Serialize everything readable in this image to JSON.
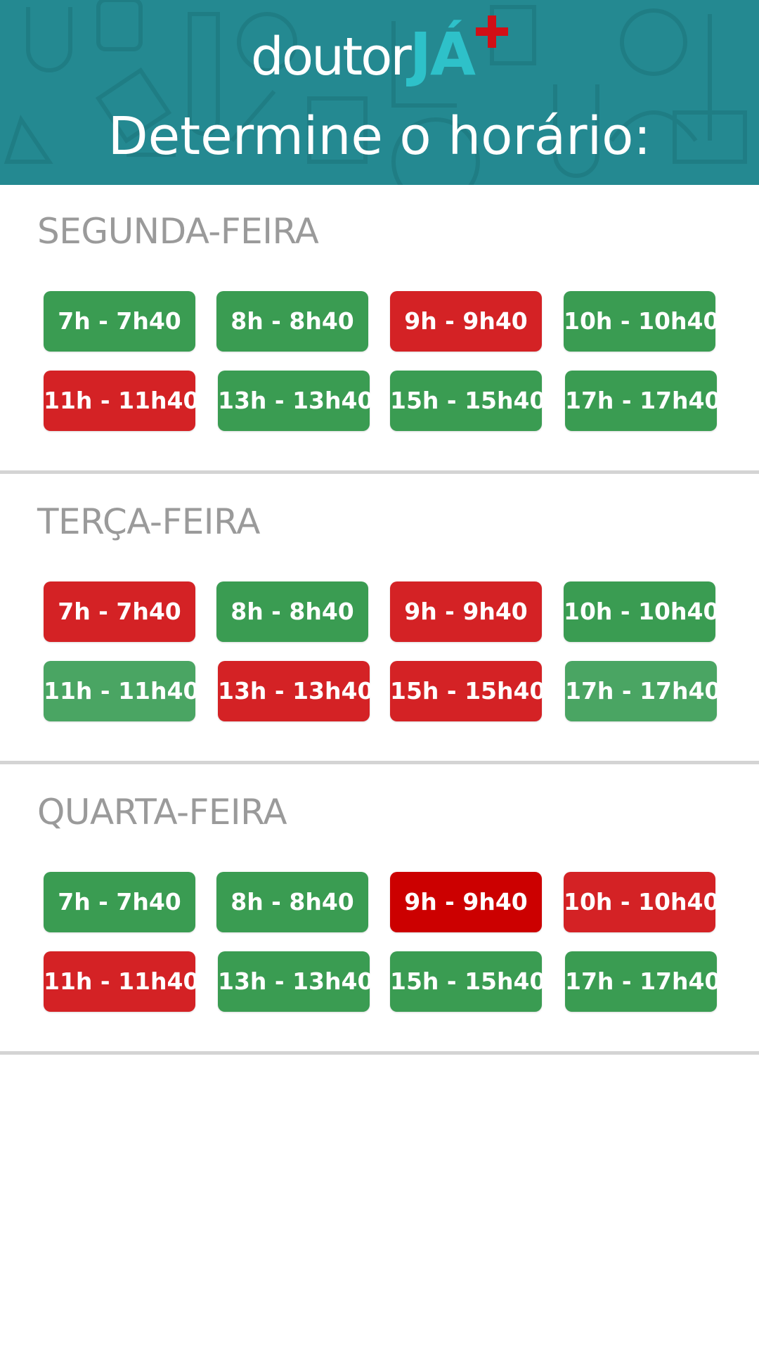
{
  "header": {
    "logo": {
      "text_main": "doutor",
      "text_accent": "JÁ"
    },
    "title": "Determine o horário:",
    "background_color": "#248991",
    "logo_accent_color": "#2ec1c9",
    "logo_plus_color": "#d10f16"
  },
  "colors": {
    "available": "#3a9c52",
    "available_light": "#4aa563",
    "unavailable": "#d42225",
    "unavailable_dark": "#cc0000"
  },
  "days": [
    {
      "name": "SEGUNDA-FEIRA",
      "slots": [
        {
          "label": "7h - 7h40",
          "status": "available"
        },
        {
          "label": "8h - 8h40",
          "status": "available"
        },
        {
          "label": "9h - 9h40",
          "status": "unavailable"
        },
        {
          "label": "10h - 10h40",
          "status": "available"
        },
        {
          "label": "11h - 11h40",
          "status": "unavailable"
        },
        {
          "label": "13h - 13h40",
          "status": "available"
        },
        {
          "label": "15h - 15h40",
          "status": "available"
        },
        {
          "label": "17h - 17h40",
          "status": "available"
        }
      ]
    },
    {
      "name": "TERÇA-FEIRA",
      "slots": [
        {
          "label": "7h - 7h40",
          "status": "unavailable"
        },
        {
          "label": "8h - 8h40",
          "status": "available"
        },
        {
          "label": "9h - 9h40",
          "status": "unavailable"
        },
        {
          "label": "10h - 10h40",
          "status": "available"
        },
        {
          "label": "11h - 11h40",
          "status": "available_light"
        },
        {
          "label": "13h - 13h40",
          "status": "unavailable"
        },
        {
          "label": "15h - 15h40",
          "status": "unavailable"
        },
        {
          "label": "17h - 17h40",
          "status": "available_light"
        }
      ]
    },
    {
      "name": "QUARTA-FEIRA",
      "slots": [
        {
          "label": "7h - 7h40",
          "status": "available"
        },
        {
          "label": "8h - 8h40",
          "status": "available"
        },
        {
          "label": "9h - 9h40",
          "status": "unavailable_dark"
        },
        {
          "label": "10h - 10h40",
          "status": "unavailable"
        },
        {
          "label": "11h - 11h40",
          "status": "unavailable"
        },
        {
          "label": "13h - 13h40",
          "status": "available"
        },
        {
          "label": "15h - 15h40",
          "status": "available"
        },
        {
          "label": "17h - 17h40",
          "status": "available"
        }
      ]
    }
  ]
}
